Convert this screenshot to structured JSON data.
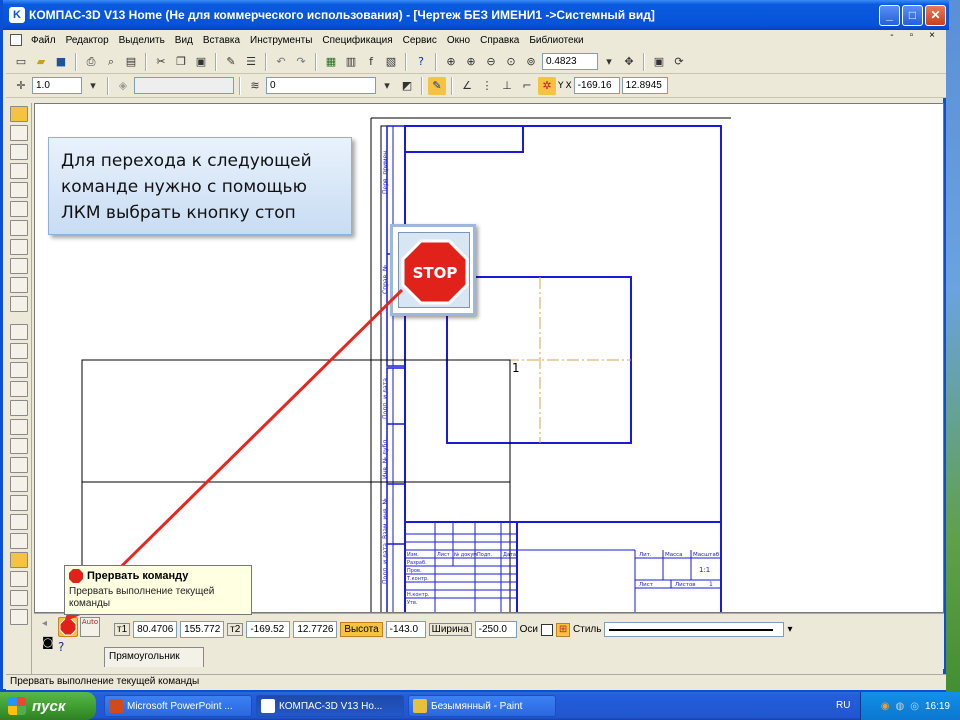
{
  "window": {
    "title": "КОМПАС-3D V13 Home (Не для коммерческого использования) - [Чертеж БЕЗ ИМЕНИ1 ->Системный вид]",
    "minimize": "_",
    "maximize": "□",
    "close": "✕"
  },
  "menu": {
    "items": [
      "Файл",
      "Редактор",
      "Выделить",
      "Вид",
      "Вставка",
      "Инструменты",
      "Спецификация",
      "Сервис",
      "Окно",
      "Справка",
      "Библиотеки"
    ]
  },
  "toolbar1": {
    "zoom_value": "0.4823"
  },
  "toolbar2": {
    "scale_value": "1.0",
    "layer_value": "0",
    "coord_x": "-169.16",
    "coord_y": "12.8945",
    "coord_x_label": "X",
    "coord_y_label": "Y"
  },
  "callout": {
    "line1": "Для перехода к следующей",
    "line2": "команде нужно с помощью",
    "line3": "ЛКМ выбрать кнопку стоп"
  },
  "stop_icon": {
    "text": "STOP"
  },
  "drawing": {
    "point_label": "1",
    "title_block": {
      "lit": "Лит.",
      "massa": "Масса",
      "masshtab": "Масштаб",
      "scale_val": "1:1",
      "list": "Лист",
      "listov": "Листов",
      "listov_val": "1",
      "izm": "Изм.",
      "list2": "Лист",
      "ndokum": "№ докум.",
      "podp": "Подп.",
      "data": "Дата",
      "razrab": "Разраб.",
      "prov": "Пров.",
      "tkontr": "Т.контр.",
      "nkontr": "Н.контр.",
      "utv": "Утв."
    },
    "side_labels": [
      "Перв. примен.",
      "Справ. №",
      "Подп. и дата",
      "Инв. № дубл.",
      "Взам. инв. №",
      "Подп. и дата",
      "Инв. № подл."
    ]
  },
  "tooltip": {
    "title": "Прервать команду",
    "desc": "Прервать выполнение текущей команды"
  },
  "propbar": {
    "auto_label": "Auto",
    "t1_label": "т1",
    "t1_x": "80.4706",
    "t1_y": "155.772",
    "t2_label": "т2",
    "t2_x": "-169.52",
    "t2_y": "12.7726",
    "height_label": "Высота",
    "height_val": "-143.0",
    "width_label": "Ширина",
    "width_val": "-250.0",
    "axes_label": "Оси",
    "style_label": "Стиль",
    "tab": "Прямоугольник"
  },
  "status": "Прервать выполнение текущей команды",
  "taskbar": {
    "start": "пуск",
    "tasks": [
      "Microsoft PowerPoint ...",
      "КОМПАС-3D V13 Ho...",
      "Безымянный - Paint"
    ],
    "lang": "RU",
    "time": "16:19"
  },
  "colors": {
    "title_blue": "#0553d8",
    "drawing_blue": "#1a1ad8",
    "stop_red": "#e0221a",
    "arrow_red": "#e8261e",
    "axis_orange": "#d8a050"
  }
}
